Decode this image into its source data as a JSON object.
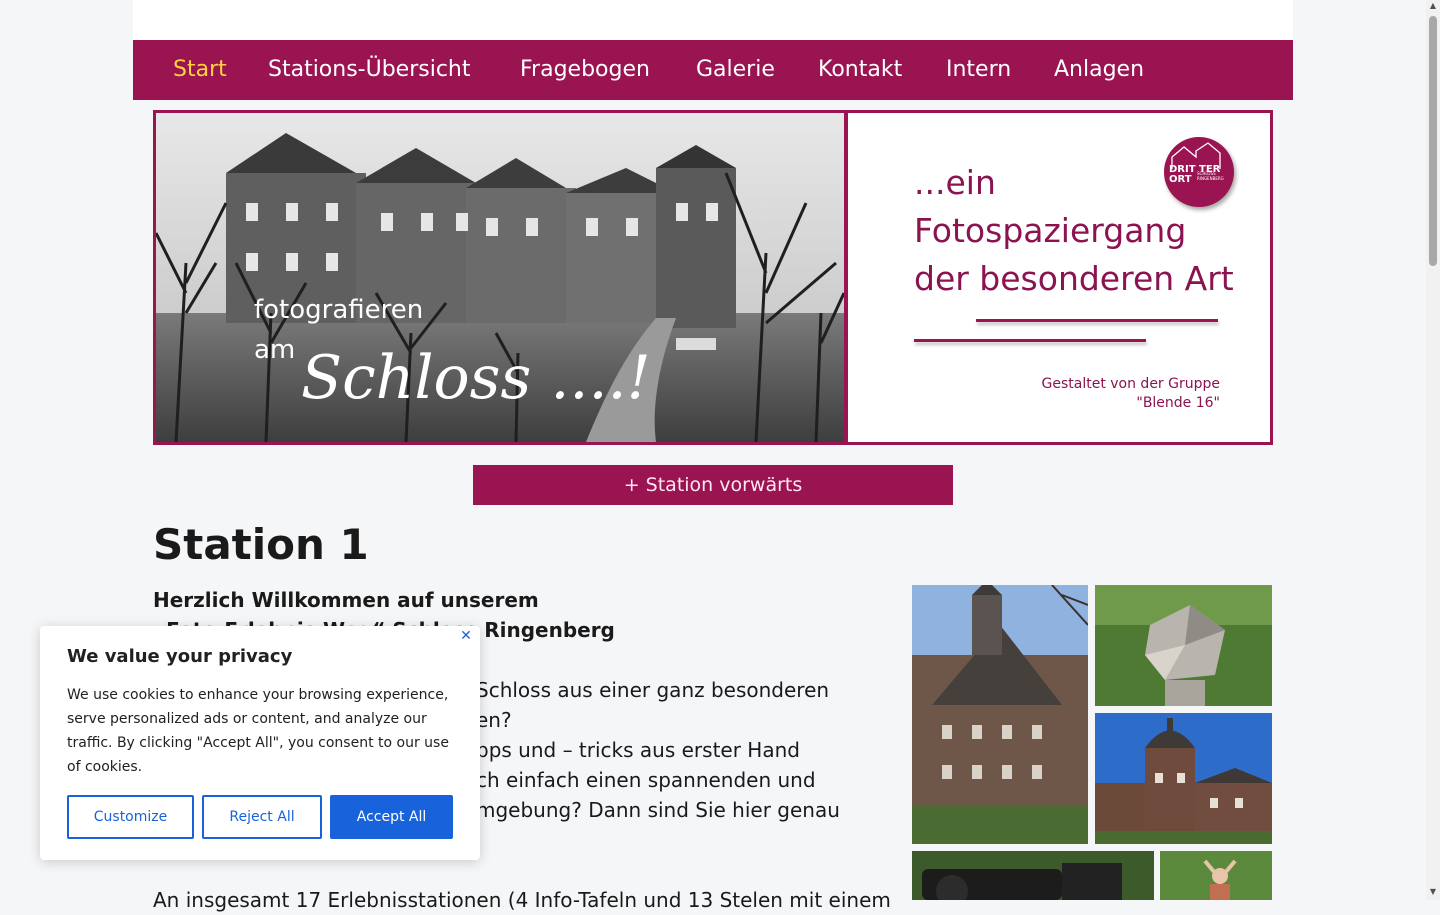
{
  "nav": {
    "items": [
      {
        "label": "Start",
        "active": true
      },
      {
        "label": "Stations-Übersicht"
      },
      {
        "label": "Fragebogen"
      },
      {
        "label": "Galerie"
      },
      {
        "label": "Kontakt"
      },
      {
        "label": "Intern"
      },
      {
        "label": "Anlagen"
      }
    ]
  },
  "banner": {
    "photo_caption_line1": "fotografieren",
    "photo_caption_line2": "am",
    "photo_caption_script": "Schloss ....!",
    "slogan_line1": "...ein",
    "slogan_line2": "Fotospaziergang",
    "slogan_line3": "der besonderen Art",
    "gestaltet_line1": "Gestaltet von der Gruppe",
    "gestaltet_line2": "\"Blende 16\"",
    "logo_text": "DRIT TER ORT",
    "logo_small": "SCHLOSS RINGENBERG"
  },
  "station_forward_button": "+ Station vorwärts",
  "main": {
    "heading": "Station 1",
    "intro_line1": "Herzlich Willkommen auf unserem",
    "intro_line2": "„Foto-Erlebnis-Weg“ Schloss Ringenberg",
    "para_lines": [
      "Schloss aus einer ganz besonderen",
      "en?",
      "pps und – tricks aus erster Hand",
      "ch einfach einen spannenden und",
      "mgebung? Dann sind Sie hier genau"
    ],
    "para2": "An insgesamt 17 Erlebnisstationen (4 Info-Tafeln und 13 Stelen mit einem"
  },
  "cookie": {
    "title": "We value your privacy",
    "text": "We use cookies to enhance your browsing experience, serve personalized ads or content, and analyze our traffic. By clicking \"Accept All\", you consent to our use of cookies.",
    "customize": "Customize",
    "reject": "Reject All",
    "accept": "Accept All"
  },
  "colors": {
    "brand": "#9a1451",
    "nav_active": "#ffd33d",
    "cookie_accent": "#1863dc"
  },
  "icons": [
    "close-icon",
    "scroll-up-icon",
    "scroll-down-icon"
  ]
}
